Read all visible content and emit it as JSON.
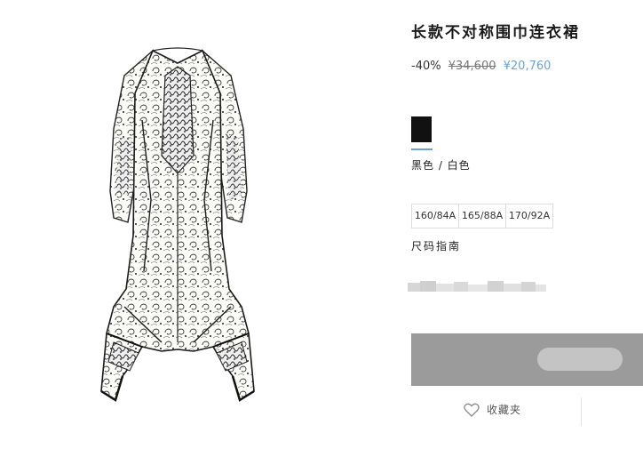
{
  "product": {
    "title": "长款不对称围巾连衣裙",
    "discount": "-40%",
    "old_price": "¥34,600",
    "new_price": "¥20,760",
    "price_color": "#6aa3d6"
  },
  "color": {
    "swatch_hex": "#111111",
    "name": "黑色 / 白色"
  },
  "sizes": [
    "160/84A",
    "165/88A",
    "170/92A"
  ],
  "size_guide": "尺码指南",
  "favorite": {
    "label": "收藏夹",
    "icon": "heart-icon"
  }
}
